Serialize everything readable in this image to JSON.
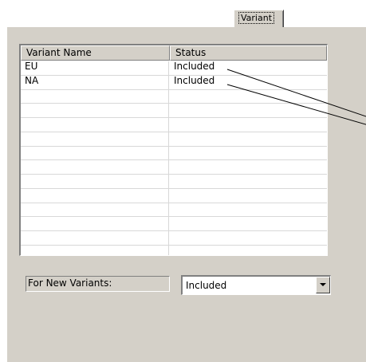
{
  "tab": {
    "label": "Variant"
  },
  "table": {
    "headers": [
      "Variant Name",
      "Status"
    ],
    "rows": [
      [
        "EU",
        "Included"
      ],
      [
        "NA",
        "Included"
      ],
      [
        "",
        ""
      ],
      [
        "",
        ""
      ],
      [
        "",
        ""
      ],
      [
        "",
        ""
      ],
      [
        "",
        ""
      ],
      [
        "",
        ""
      ],
      [
        "",
        ""
      ],
      [
        "",
        ""
      ],
      [
        "",
        ""
      ],
      [
        "",
        ""
      ],
      [
        "",
        ""
      ],
      [
        "",
        ""
      ]
    ]
  },
  "new_variants": {
    "label": "For New Variants:",
    "selected": "Included"
  }
}
